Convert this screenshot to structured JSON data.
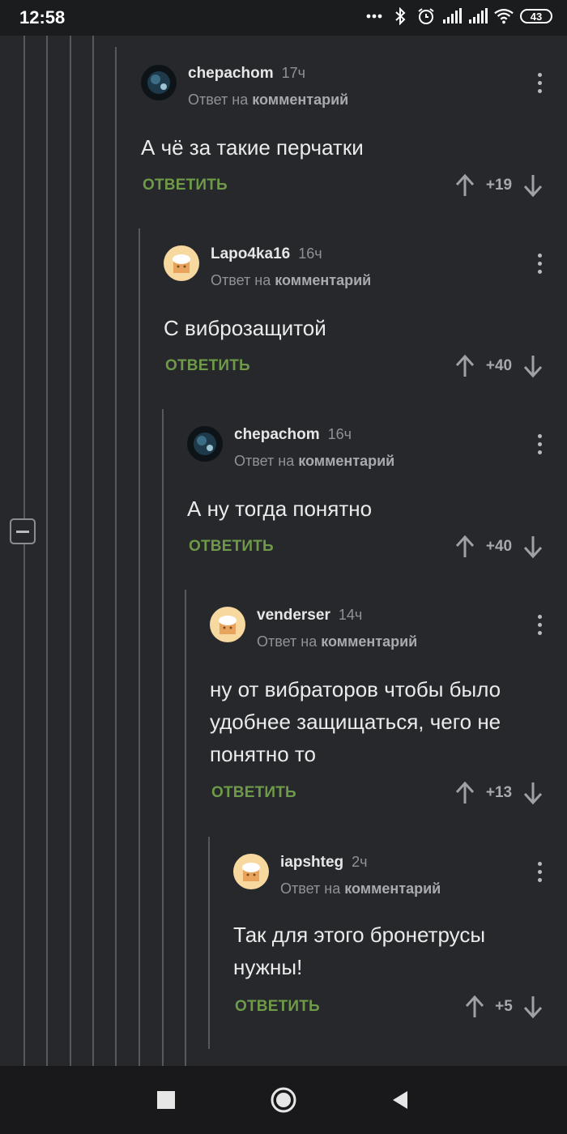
{
  "status_bar": {
    "time": "12:58",
    "battery": "43"
  },
  "comments": [
    {
      "author": "chepachom",
      "time": "17ч",
      "reply_prefix": "Ответ на",
      "reply_target": "комментарий",
      "lines": [
        "А чё за такие перчатки"
      ],
      "reply_label": "ОТВЕТИТЬ",
      "score": "+19",
      "avatar": "dark"
    },
    {
      "author": "Lapo4ka16",
      "time": "16ч",
      "reply_prefix": "Ответ на",
      "reply_target": "комментарий",
      "lines": [
        "С виброзащитой"
      ],
      "reply_label": "ОТВЕТИТЬ",
      "score": "+40",
      "avatar": "cook"
    },
    {
      "author": "chepachom",
      "time": "16ч",
      "reply_prefix": "Ответ на",
      "reply_target": "комментарий",
      "lines": [
        "А ну тогда понятно"
      ],
      "reply_label": "ОТВЕТИТЬ",
      "score": "+40",
      "avatar": "dark"
    },
    {
      "author": "venderser",
      "time": "14ч",
      "reply_prefix": "Ответ на",
      "reply_target": "комментарий",
      "lines": [
        "ну от вибраторов чтобы было",
        "удобнее защищаться, чего не",
        "понятно то"
      ],
      "reply_label": "ОТВЕТИТЬ",
      "score": "+13",
      "avatar": "cook"
    },
    {
      "author": "iapshteg",
      "time": "2ч",
      "reply_prefix": "Ответ на",
      "reply_target": "комментарий",
      "lines": [
        "Так для этого бронетрусы",
        "нужны!"
      ],
      "reply_label": "ОТВЕТИТЬ",
      "score": "+5",
      "avatar": "cook"
    }
  ],
  "colors": {
    "background": "#26282b",
    "accent": "#6e9a4a",
    "thread_line": "#55585c"
  },
  "icons": [
    "wifi-icon",
    "bluetooth-icon",
    "alarm-icon",
    "signal-icon",
    "battery-icon",
    "kebab-icon",
    "upvote-icon",
    "downvote-icon",
    "collapse-icon",
    "stop-icon",
    "home-icon",
    "back-icon"
  ]
}
